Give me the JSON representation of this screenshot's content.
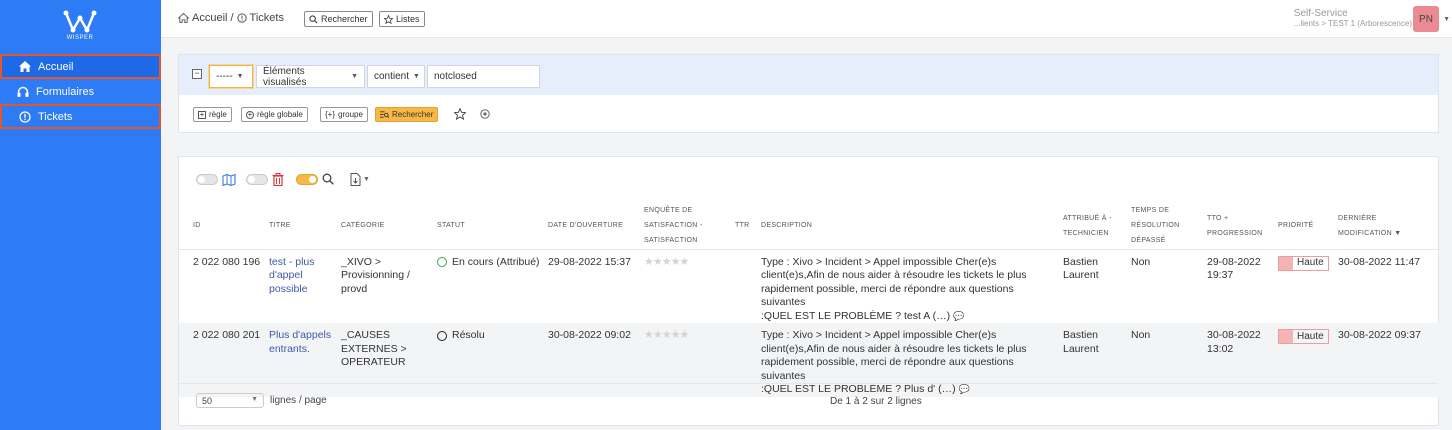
{
  "logo": {
    "brand": "WISPER"
  },
  "sidebar": {
    "items": [
      {
        "label": "Accueil",
        "icon": "home-icon"
      },
      {
        "label": "Formulaires",
        "icon": "headset-icon"
      },
      {
        "label": "Tickets",
        "icon": "info-circle-icon"
      }
    ]
  },
  "breadcrumb": {
    "home": "Accueil",
    "separator": "/",
    "current": "Tickets"
  },
  "toolbar": {
    "search_label": "Rechercher",
    "lists_label": "Listes"
  },
  "user": {
    "profile": "Self-Service",
    "entity": "...lients > TEST 1 (Arborescence)",
    "initials": "PN"
  },
  "filter": {
    "collapse": "−",
    "link": "-----",
    "field": "Éléments visualisés",
    "operator": "contient",
    "value": "notclosed",
    "buttons": {
      "rule": "règle",
      "global_rule": "règle globale",
      "group": "groupe",
      "search": "Rechercher"
    }
  },
  "table": {
    "headers": {
      "id": "ID",
      "title": "TITRE",
      "category": "CATÉGORIE",
      "status": "STATUT",
      "open_date": "DATE D'OUVERTURE",
      "survey_1": "ENQUÊTE DE",
      "survey_2": "SATISFACTION -",
      "survey_3": "SATISFACTION",
      "ttr": "TTR",
      "description": "DESCRIPTION",
      "assigned_1": "ATTRIBUÉ À -",
      "assigned_2": "TECHNICIEN",
      "restime_1": "TEMPS DE",
      "restime_2": "RÉSOLUTION",
      "restime_3": "DÉPASSÉ",
      "tto_1": "TTO +",
      "tto_2": "PROGRESSION",
      "priority": "PRIORITÉ",
      "lastmod_1": "DERNIÈRE",
      "lastmod_2": "MODIFICATION"
    },
    "rows": [
      {
        "id": "2 022 080 196",
        "title": [
          "test - plus",
          "d'appel",
          "possible"
        ],
        "category": [
          "_XIVO >",
          "Provisionning /",
          "provd"
        ],
        "status": "En cours (Attribué)",
        "status_color": "#3aa655",
        "open_date": "29-08-2022 15:37",
        "stars": "★★★★★",
        "description": [
          "Type : Xivo > Incident > Appel impossible Cher(e)s",
          "client(e)s,Afin de nous aider à résoudre les tickets le plus",
          "rapidement possible, merci de répondre aux questions suivantes",
          ":QUEL EST LE PROBLÈME ? test A  (…)"
        ],
        "assigned": [
          "Bastien",
          "Laurent"
        ],
        "res_overdue": "Non",
        "tto": [
          "29-08-2022",
          "19:37"
        ],
        "priority": "Haute",
        "lastmod": "30-08-2022 11:47"
      },
      {
        "id": "2 022 080 201",
        "title": [
          "Plus d'appels",
          "entrants."
        ],
        "category": [
          "_CAUSES",
          "EXTERNES >",
          "OPERATEUR"
        ],
        "status": "Résolu",
        "status_color": "#222222",
        "open_date": "30-08-2022 09:02",
        "stars": "★★★★★",
        "description": [
          "Type : Xivo > Incident > Appel impossible Cher(e)s",
          "client(e)s,Afin de nous aider à résoudre les tickets le plus",
          "rapidement possible, merci de répondre aux questions suivantes",
          ":QUEL EST LE PROBLÈME ? Plus d' (…)"
        ],
        "assigned": [
          "Bastien",
          "Laurent"
        ],
        "res_overdue": "Non",
        "tto": [
          "30-08-2022",
          "13:02"
        ],
        "priority": "Haute",
        "lastmod": "30-08-2022 09:37"
      }
    ]
  },
  "pagination": {
    "page_size": "50",
    "lines_label": "lignes / page",
    "info": "De 1 à 2 sur 2 lignes"
  },
  "colors": {
    "sidebar": "#2d7cf6",
    "accent": "#f9b845",
    "highlight": "#e4572e",
    "priority": "#f4b4b4"
  }
}
